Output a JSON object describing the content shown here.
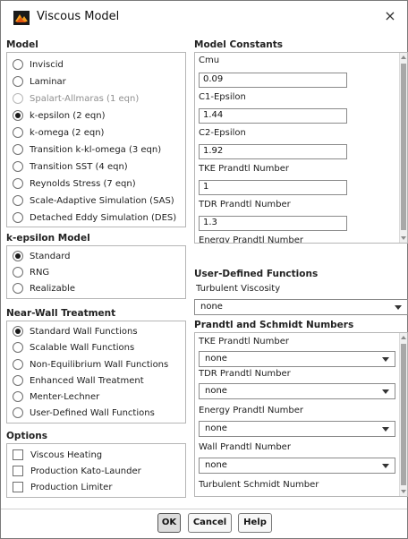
{
  "window": {
    "title": "Viscous Model",
    "close_icon": "×"
  },
  "model": {
    "title": "Model",
    "options": [
      {
        "label": "Inviscid",
        "selected": false,
        "disabled": false
      },
      {
        "label": "Laminar",
        "selected": false,
        "disabled": false
      },
      {
        "label": "Spalart-Allmaras (1 eqn)",
        "selected": false,
        "disabled": true
      },
      {
        "label": "k-epsilon (2 eqn)",
        "selected": true,
        "disabled": false
      },
      {
        "label": "k-omega (2 eqn)",
        "selected": false,
        "disabled": false
      },
      {
        "label": "Transition k-kl-omega (3 eqn)",
        "selected": false,
        "disabled": false
      },
      {
        "label": "Transition SST (4 eqn)",
        "selected": false,
        "disabled": false
      },
      {
        "label": "Reynolds Stress (7 eqn)",
        "selected": false,
        "disabled": false
      },
      {
        "label": "Scale-Adaptive Simulation (SAS)",
        "selected": false,
        "disabled": false
      },
      {
        "label": "Detached Eddy Simulation (DES)",
        "selected": false,
        "disabled": false
      }
    ]
  },
  "k_epsilon_model": {
    "title": "k-epsilon Model",
    "options": [
      {
        "label": "Standard",
        "selected": true
      },
      {
        "label": "RNG",
        "selected": false
      },
      {
        "label": "Realizable",
        "selected": false
      }
    ]
  },
  "near_wall": {
    "title": "Near-Wall Treatment",
    "options": [
      {
        "label": "Standard Wall Functions",
        "selected": true
      },
      {
        "label": "Scalable Wall Functions",
        "selected": false
      },
      {
        "label": "Non-Equilibrium Wall Functions",
        "selected": false
      },
      {
        "label": "Enhanced Wall Treatment",
        "selected": false
      },
      {
        "label": "Menter-Lechner",
        "selected": false
      },
      {
        "label": "User-Defined Wall Functions",
        "selected": false
      }
    ]
  },
  "options": {
    "title": "Options",
    "items": [
      {
        "label": "Viscous Heating",
        "checked": false
      },
      {
        "label": "Production Kato-Launder",
        "checked": false
      },
      {
        "label": "Production Limiter",
        "checked": false
      }
    ]
  },
  "model_constants": {
    "title": "Model Constants",
    "items": [
      {
        "label": "Cmu",
        "value": "0.09"
      },
      {
        "label": "C1-Epsilon",
        "value": "1.44"
      },
      {
        "label": "C2-Epsilon",
        "value": "1.92"
      },
      {
        "label": "TKE Prandtl Number",
        "value": "1"
      },
      {
        "label": "TDR Prandtl Number",
        "value": "1.3"
      },
      {
        "label": "Energy Prandtl Number",
        "value": ""
      }
    ]
  },
  "udf": {
    "title": "User-Defined Functions",
    "turbulent_viscosity_label": "Turbulent Viscosity",
    "turbulent_viscosity_value": "none"
  },
  "prandtl_schmidt": {
    "title": "Prandtl and Schmidt Numbers",
    "items": [
      {
        "label": "TKE Prandtl Number",
        "value": "none"
      },
      {
        "label": "TDR Prandtl Number",
        "value": "none"
      },
      {
        "label": "Energy Prandtl Number",
        "value": "none"
      },
      {
        "label": "Wall Prandtl Number",
        "value": "none"
      },
      {
        "label": "Turbulent Schmidt Number",
        "value": ""
      }
    ]
  },
  "buttons": {
    "ok": "OK",
    "cancel": "Cancel",
    "help": "Help"
  },
  "colors": {
    "accent": "#1b1b1b",
    "border": "#b5b5b5",
    "scroll_thumb": "#a8a8a8"
  }
}
